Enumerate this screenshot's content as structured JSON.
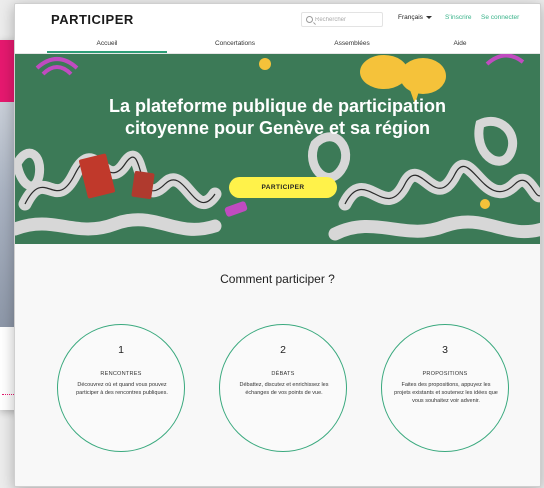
{
  "site": {
    "brand": "PARTICIPER"
  },
  "header": {
    "search_placeholder": "Rechercher",
    "language": "Français",
    "signup": "S'inscrire",
    "login": "Se connecter"
  },
  "nav": {
    "tabs": [
      {
        "label": "Accueil",
        "active": true
      },
      {
        "label": "Concertations"
      },
      {
        "label": "Assemblées"
      },
      {
        "label": "Aide"
      }
    ]
  },
  "hero": {
    "title_line1": "La plateforme publique de participation",
    "title_line2": "citoyenne pour Genève et sa région",
    "cta_label": "PARTICIPER"
  },
  "how": {
    "title": "Comment participer ?",
    "steps": [
      {
        "number": "1",
        "title": "RENCONTRES",
        "desc": "Découvrez où et quand vous pouvez participer à des rencontres publiques."
      },
      {
        "number": "2",
        "title": "DÉBATS",
        "desc": "Débattez, discutez et enrichissez les échanges de vos points de vue."
      },
      {
        "number": "3",
        "title": "PROPOSITIONS",
        "desc": "Faites des propositions, appuyez les projets existants et soutenez les idées que vous souhaitez voir advenir."
      }
    ]
  },
  "colors": {
    "accent": "#2e9e77",
    "hero_bg": "#3c7a57",
    "cta": "#fff24a",
    "pink": "#e6196f"
  }
}
